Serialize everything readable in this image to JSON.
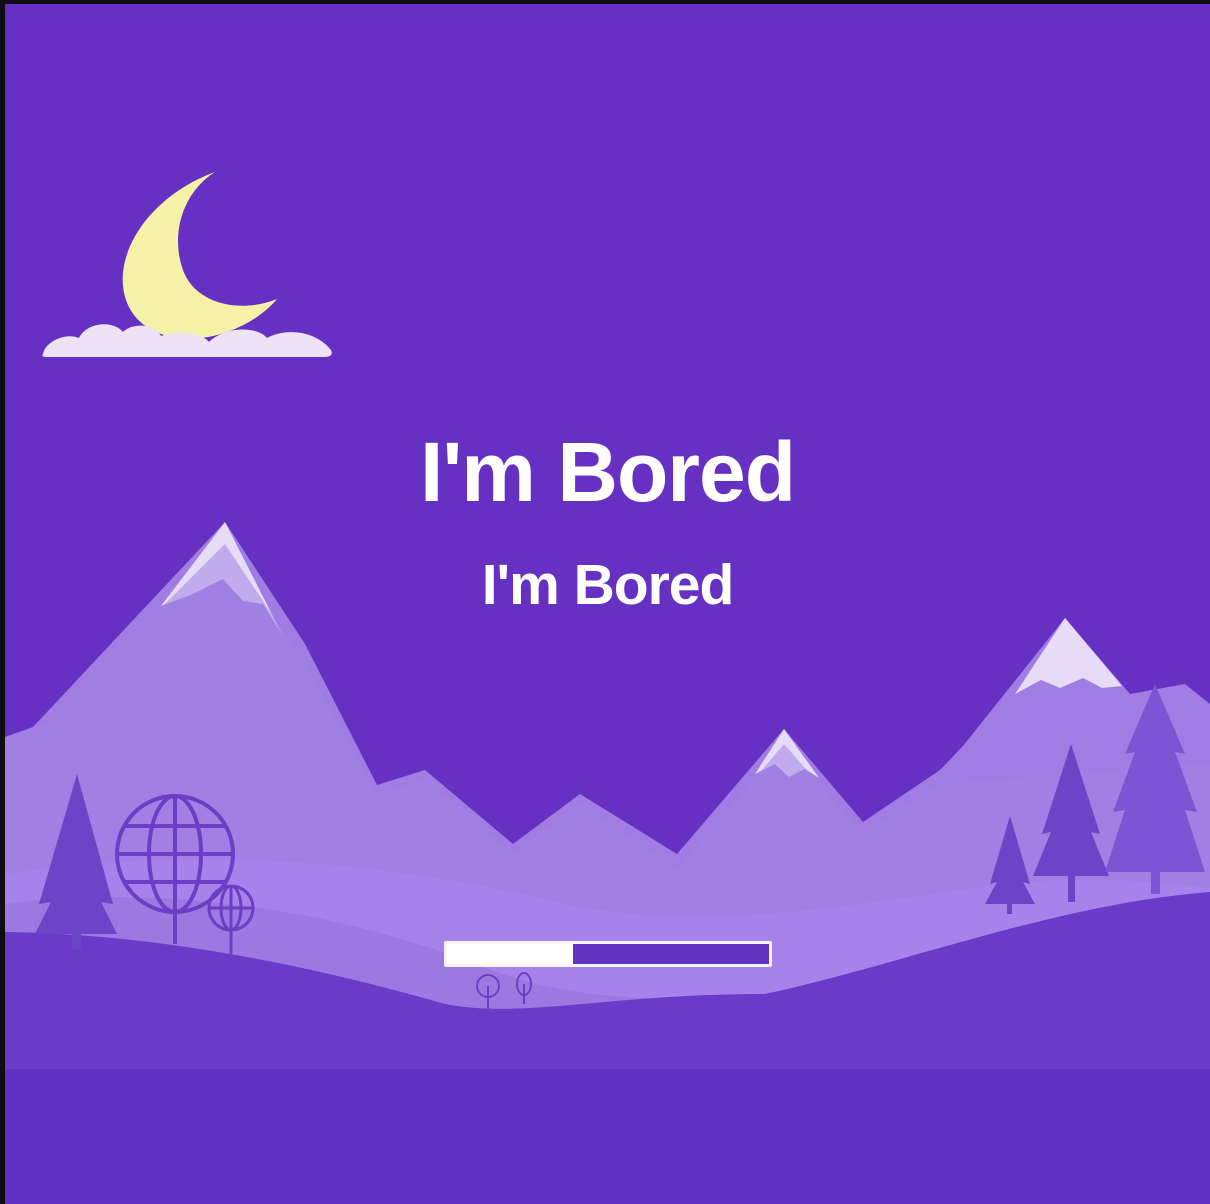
{
  "title": "I'm Bored",
  "subtitle": "I'm Bored",
  "progress": {
    "fraction": 0.39
  },
  "colors": {
    "sky": "#6631c3",
    "moon": "#f4f1a6",
    "cloud": "#eeddf6",
    "mountain_far": "#a07fe3",
    "mountain_mid": "#a889ec",
    "snow": "#e6dcf6",
    "hill": "#9b7ce3",
    "tree": "#6b45c8",
    "foreground": "#6636c7",
    "progress_track": "#6232c0",
    "progress_fill": "#ffffff"
  },
  "icons": [
    "crescent-moon-icon",
    "cloud-icon",
    "mountain-icon",
    "pine-tree-icon",
    "globe-tree-icon",
    "small-tree-icon"
  ]
}
